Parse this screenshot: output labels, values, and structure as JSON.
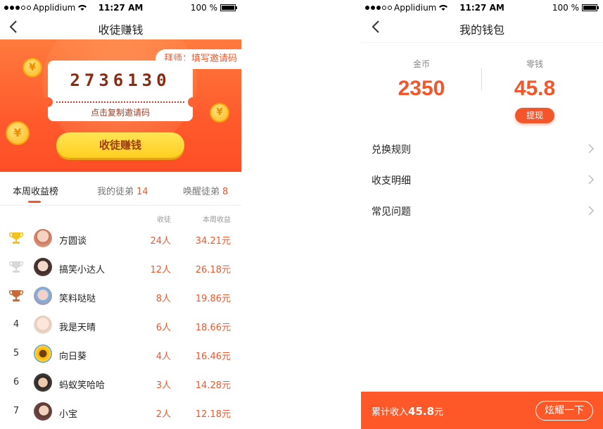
{
  "status_bar": {
    "carrier": "Applidium",
    "time": "11:27 AM",
    "battery": "100 %"
  },
  "left": {
    "title": "收徒赚钱",
    "invite_chip": "拜师：填写邀请码",
    "invite_code": "2736130",
    "copy_hint": "点击复制邀请码",
    "cta_label": "收徒赚钱",
    "coin_symbol": "¥",
    "tabs": [
      {
        "label": "本周收益榜",
        "count": ""
      },
      {
        "label": "我的徒弟",
        "count": "14"
      },
      {
        "label": "唤醒徒弟",
        "count": "8"
      }
    ],
    "table_headers": {
      "disciples": "收徒",
      "weekly_earnings": "本周收益"
    },
    "rows": [
      {
        "rank": "1",
        "name": "方圆谈",
        "disciples": "24人",
        "earnings": "34.21元"
      },
      {
        "rank": "2",
        "name": "搞笑小达人",
        "disciples": "12人",
        "earnings": "26.18元"
      },
      {
        "rank": "3",
        "name": "笑料哒哒",
        "disciples": "8人",
        "earnings": "19.86元"
      },
      {
        "rank": "4",
        "name": "我是天晴",
        "disciples": "6人",
        "earnings": "18.66元"
      },
      {
        "rank": "5",
        "name": "向日葵",
        "disciples": "4人",
        "earnings": "16.46元"
      },
      {
        "rank": "6",
        "name": "蚂蚁笑哈哈",
        "disciples": "3人",
        "earnings": "14.28元"
      },
      {
        "rank": "7",
        "name": "小宝",
        "disciples": "2人",
        "earnings": "12.18元"
      }
    ]
  },
  "right": {
    "title": "我的钱包",
    "coins_label": "金币",
    "coins_value": "2350",
    "cash_label": "零钱",
    "cash_value": "45.8",
    "withdraw_label": "提现",
    "menu": [
      {
        "label": "兑换规则"
      },
      {
        "label": "收支明细"
      },
      {
        "label": "常见问题"
      }
    ],
    "total_prefix": "累计收入",
    "total_amount": "45.8",
    "total_unit": "元",
    "share_label": "炫耀一下"
  },
  "colors": {
    "accent": "#f4552a",
    "gold": "#ffcf1f",
    "silver": "#d8d8d8",
    "bronze": "#c8693a"
  }
}
